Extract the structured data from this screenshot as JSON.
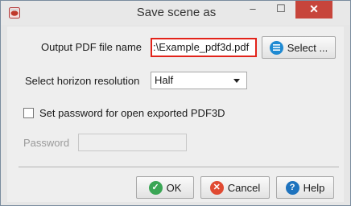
{
  "window": {
    "title": "Save scene as",
    "minimize_glyph": "–",
    "maximize_glyph": "☐",
    "close_glyph": "✕"
  },
  "form": {
    "output_label": "Output PDF file name",
    "output_value": ":\\Example_pdf3d.pdf",
    "select_button": "Select ...",
    "horizon_label": "Select horizon resolution",
    "horizon_value": "Half",
    "password_checkbox_label": "Set password for open exported PDF3D",
    "password_checked": false,
    "password_label": "Password",
    "password_value": ""
  },
  "buttons": {
    "ok": "OK",
    "cancel": "Cancel",
    "help": "Help"
  },
  "icons": {
    "app": "app-icon",
    "select": "list-icon",
    "ok": "check-icon",
    "cancel": "cross-icon",
    "help": "question-icon"
  },
  "colors": {
    "highlight_border": "#e2231a",
    "close_button": "#c7453b",
    "ok_icon": "#3aa655",
    "cancel_icon": "#e04a32",
    "select_icon": "#1f8ad2",
    "help_icon": "#1e73be"
  }
}
